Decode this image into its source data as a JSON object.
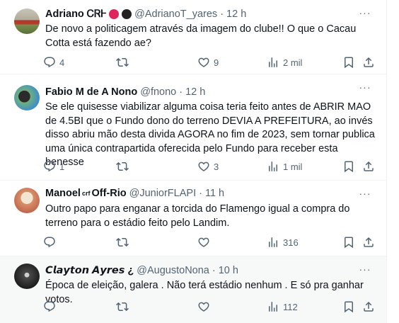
{
  "tweets": [
    {
      "name": "Adriano ᏟᏒᎰ",
      "handle": "@AdrianoT_yares",
      "time": "12 h",
      "text": "De novo a politicagem através da imagem do clube!! O que o Cacau Cotta está fazendo ae?",
      "replies": "4",
      "retweets": "",
      "likes": "9",
      "views": "2 mil",
      "avatar_icon": "profile-photo"
    },
    {
      "name": "Fabio M de A Nono",
      "handle": "@fnono",
      "time": "12 h",
      "text": "Se ele quisesse viabilizar alguma coisa teria feito antes de ABRIR MAO de 4.5BI que o Fundo dono do terreno DEVIA A PREFEITURA, ao invés disso abriu mão desta divida AGORA no fim de 2023, sem tornar publica uma única contrapartida oferecida pelo Fundo para receber esta benesse",
      "replies": "1",
      "retweets": "",
      "likes": "3",
      "views": "1 mil",
      "avatar_icon": "profile-photo"
    },
    {
      "name": "Manoel",
      "name_sup": "crf",
      "name_suffix": "Off-Rio",
      "handle": "@JuniorFLAPI",
      "time": "11 h",
      "text": "Outro papo para enganar a torcida do Flamengo igual a compra do terreno para o estádio feito pelo Landim.",
      "replies": "",
      "retweets": "",
      "likes": "",
      "views": "316",
      "avatar_icon": "profile-photo"
    },
    {
      "name": "𝘾𝙡𝙖𝙮𝙩𝙤𝙣 𝘼𝙮𝙧𝙚𝙨 ¿",
      "handle": "@AugustoNona",
      "time": "10 h",
      "text": "Época de eleição, galera . Não terá estádio nenhum . E só pra ganhar votos.",
      "replies": "",
      "retweets": "",
      "likes": "",
      "views": "112",
      "avatar_icon": "profile-photo"
    }
  ],
  "ui": {
    "dot": "·",
    "more_glyph": "···"
  },
  "colors": {
    "text": "#0f1419",
    "secondary": "#536471",
    "border": "#eff3f4",
    "hover_bg": "#f7f9f9"
  }
}
